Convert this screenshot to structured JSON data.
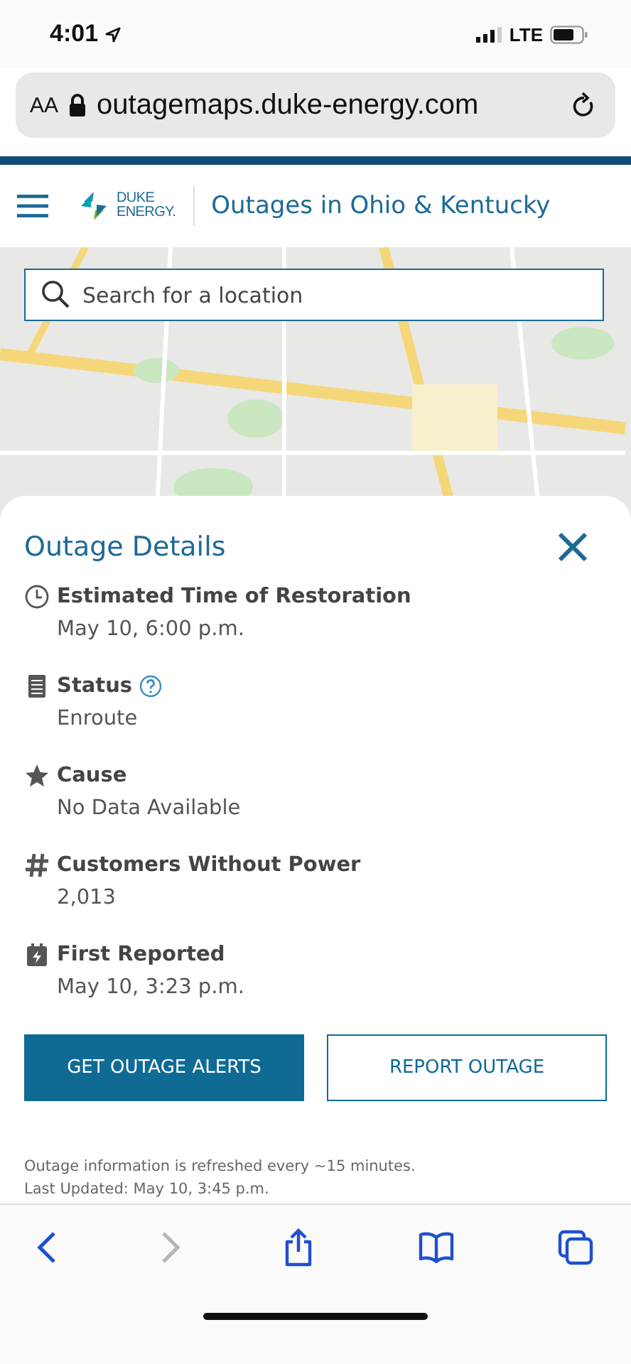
{
  "status_bar": {
    "time": "4:01",
    "network": "LTE"
  },
  "browser": {
    "text_size": "AA",
    "url": "outagemaps.duke-energy.com"
  },
  "header": {
    "logo_lines": [
      "DUKE",
      "ENERGY."
    ],
    "title": "Outages in Ohio & Kentucky"
  },
  "map": {
    "kind": "picture",
    "search": {
      "placeholder": "Search for a location"
    }
  },
  "panel": {
    "title": "Outage Details",
    "details": [
      {
        "kind": "clock",
        "label": "Estimated Time of Restoration",
        "value": "May 10, 6:00 p.m.",
        "help": false
      },
      {
        "kind": "status",
        "label": "Status",
        "value": "Enroute",
        "help": true
      },
      {
        "kind": "star",
        "label": "Cause",
        "value": "No Data Available",
        "help": false
      },
      {
        "kind": "hash",
        "label": "Customers Without Power",
        "value": "2,013",
        "help": false
      },
      {
        "kind": "calendar",
        "label": "First Reported",
        "value": "May 10, 3:23 p.m.",
        "help": false
      }
    ],
    "buttons": [
      {
        "label": "GET OUTAGE ALERTS",
        "kind": "primary"
      },
      {
        "label": "REPORT OUTAGE",
        "kind": "outline"
      }
    ],
    "notes": [
      "Outage information is refreshed every ~15 minutes.",
      "Last Updated: May 10, 3:45 p.m."
    ]
  },
  "toolbar": {
    "back_disabled": false,
    "forward_disabled": true
  }
}
